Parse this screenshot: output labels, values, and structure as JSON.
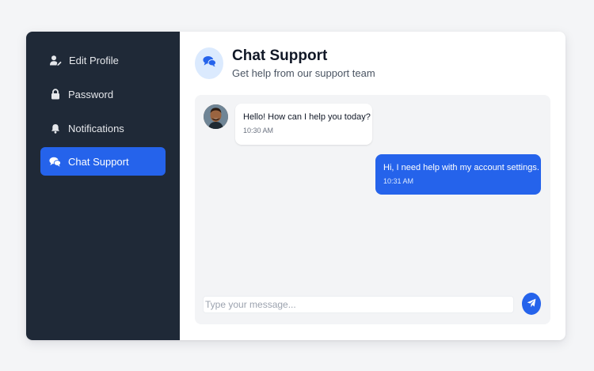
{
  "sidebar": {
    "items": [
      {
        "label": "Edit Profile",
        "icon": "user-edit-icon"
      },
      {
        "label": "Password",
        "icon": "lock-icon"
      },
      {
        "label": "Notifications",
        "icon": "bell-icon"
      },
      {
        "label": "Chat Support",
        "icon": "comments-icon",
        "active": true
      }
    ]
  },
  "header": {
    "title": "Chat Support",
    "subtitle": "Get help from our support team",
    "icon": "comments-icon"
  },
  "chat": {
    "messages": [
      {
        "from": "agent",
        "text": "Hello! How can I help you today?",
        "time": "10:30 AM"
      },
      {
        "from": "user",
        "text": "Hi, I need help with my account settings.",
        "time": "10:31 AM"
      }
    ],
    "input": {
      "value": "",
      "placeholder": "Type your message..."
    },
    "send_icon": "paper-plane-icon"
  },
  "colors": {
    "sidebar_bg": "#1f2937",
    "accent": "#2563eb",
    "header_icon_bg": "#dbeafe",
    "chat_bg": "#f3f4f6",
    "page_bg": "#f4f5f7"
  }
}
